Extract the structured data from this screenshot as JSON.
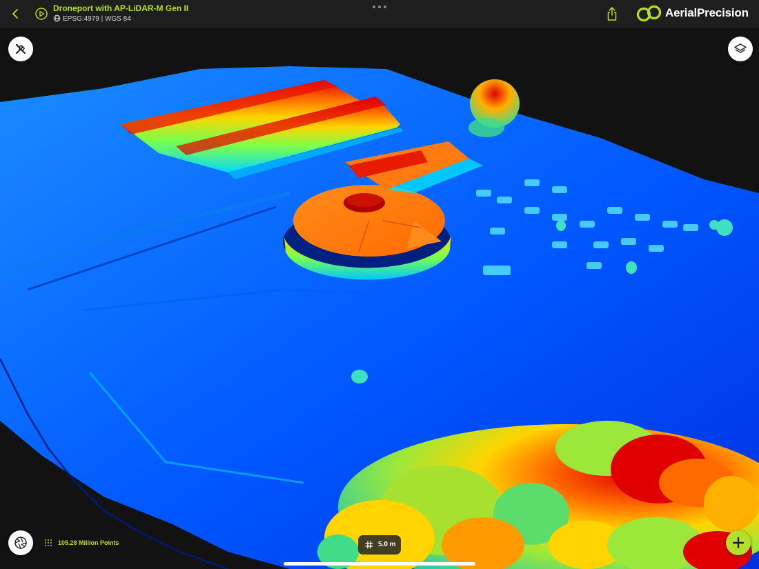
{
  "header": {
    "project_title": "Droneport with AP-LiDAR-M Gen II",
    "crs": "EPSG:4979 | WGS 84",
    "brand": "AerialPrecision"
  },
  "icons": {
    "back": "chevron-left-icon",
    "project": "play-circle-icon",
    "crs": "globe-icon",
    "more": "ellipsis-icon",
    "share": "share-icon",
    "tools": "tools-icon",
    "layers": "layers-icon",
    "camera": "aperture-icon",
    "points": "point-cloud-icon",
    "grid": "grid-icon",
    "add": "plus-icon"
  },
  "viewport": {
    "point_count": "105.28 Million Points",
    "grid_size": "5.0 m"
  },
  "colors": {
    "accent": "#b6df28",
    "topbar": "#1e1e1e",
    "background": "#121212",
    "elevation_low": "#0033ff",
    "elevation_high": "#d40000"
  }
}
